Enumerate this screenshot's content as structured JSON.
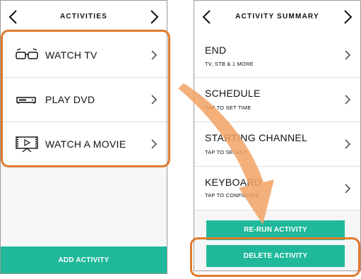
{
  "left_screen": {
    "title": "ACTIVITIES",
    "items": [
      {
        "label": "WATCH TV",
        "icon": "3d-glasses-icon"
      },
      {
        "label": "PLAY DVD",
        "icon": "dvd-player-icon"
      },
      {
        "label": "WATCH A MOVIE",
        "icon": "movie-screen-icon"
      }
    ],
    "add_button": "ADD ACTIVITY"
  },
  "right_screen": {
    "title": "ACTIVITY SUMMARY",
    "items": [
      {
        "label": "END",
        "sublabel": "TV, STB & 1 MORE"
      },
      {
        "label": "SCHEDULE",
        "sublabel": "TAP TO SET TIME"
      },
      {
        "label": "STARTING CHANNEL",
        "sublabel": "TAP TO SELECT"
      },
      {
        "label": "KEYBOARD",
        "sublabel": "TAP TO CONFIGURE"
      }
    ],
    "rerun_button": "RE-RUN ACTIVITY",
    "delete_button": "DELETE ACTIVITY"
  },
  "colors": {
    "accent_green": "#1fb89a",
    "highlight_orange": "#e07a2e"
  }
}
